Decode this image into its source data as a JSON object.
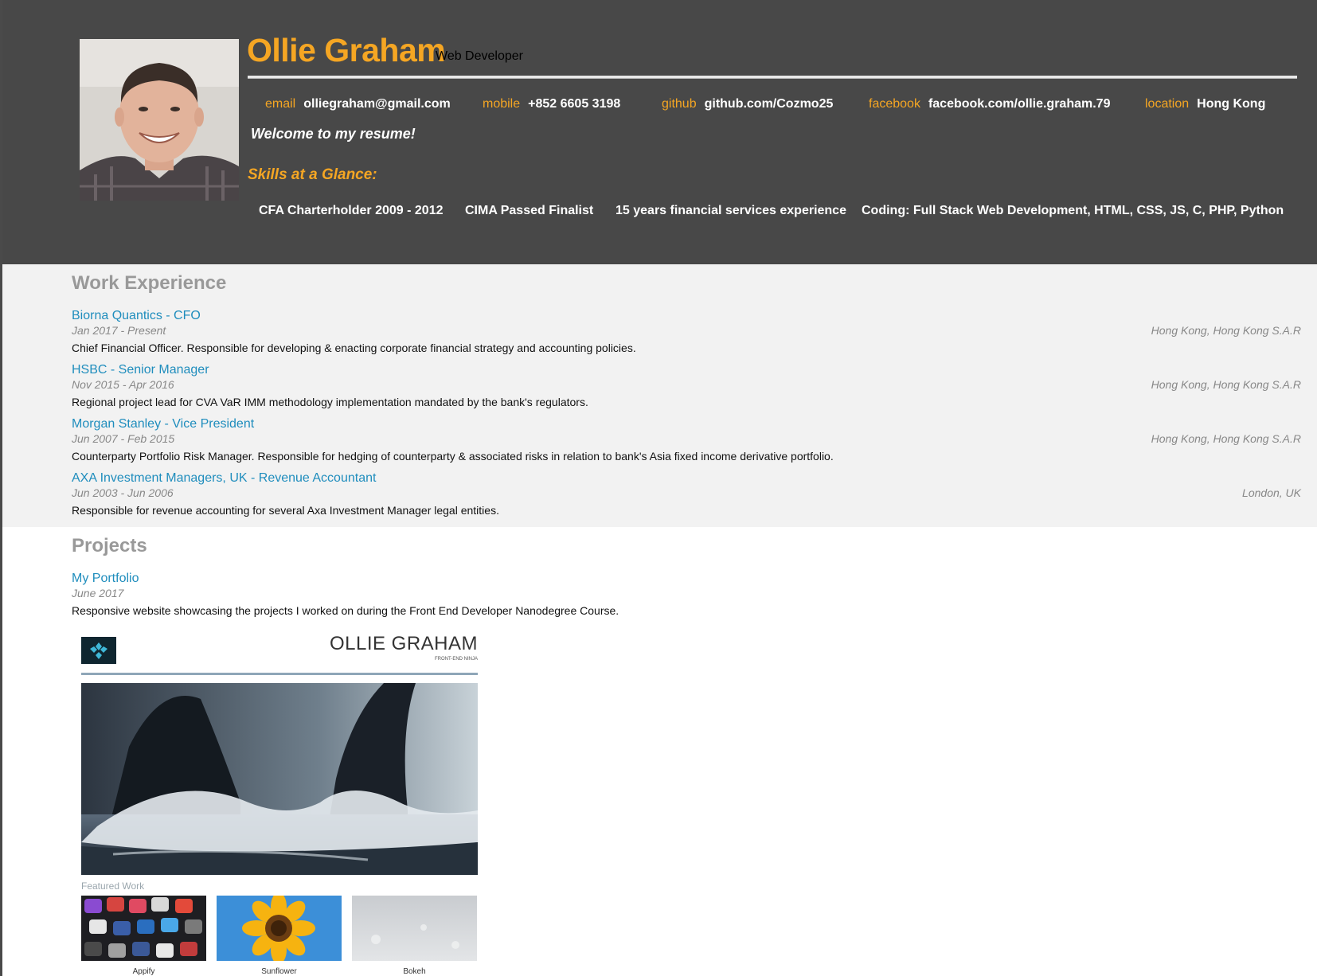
{
  "header": {
    "name": "Ollie Graham",
    "role": "Web Developer",
    "welcome": "Welcome to my resume!",
    "contacts": [
      {
        "key": "email",
        "value": "olliegraham@gmail.com"
      },
      {
        "key": "mobile",
        "value": "+852 6605 3198"
      },
      {
        "key": "github",
        "value": "github.com/Cozmo25"
      },
      {
        "key": "facebook",
        "value": "facebook.com/ollie.graham.79"
      },
      {
        "key": "location",
        "value": "Hong Kong"
      }
    ],
    "skills_title": "Skills at a Glance:",
    "skills": [
      "CFA Charterholder 2009 - 2012",
      "CIMA Passed Finalist",
      "15 years financial services experience",
      "Coding: Full Stack Web Development, HTML, CSS, JS, C, PHP, Python"
    ]
  },
  "work": {
    "title": "Work Experience",
    "jobs": [
      {
        "title": "Biorna Quantics - CFO",
        "dates": "Jan 2017 - Present",
        "location": "Hong Kong, Hong Kong S.A.R",
        "description": "Chief Financial Officer. Responsible for developing & enacting corporate financial strategy and accounting policies."
      },
      {
        "title": "HSBC - Senior Manager",
        "dates": "Nov 2015 - Apr 2016",
        "location": "Hong Kong, Hong Kong S.A.R",
        "description": "Regional project lead for CVA VaR IMM methodology implementation mandated by the bank's regulators."
      },
      {
        "title": "Morgan Stanley - Vice President",
        "dates": "Jun 2007 - Feb 2015",
        "location": "Hong Kong, Hong Kong S.A.R",
        "description": "Counterparty Portfolio Risk Manager. Responsible for hedging of counterparty & associated risks in relation to bank's Asia fixed income derivative portfolio."
      },
      {
        "title": "AXA Investment Managers, UK - Revenue Accountant",
        "dates": "Jun 2003 - Jun 2006",
        "location": "London, UK",
        "description": "Responsible for revenue accounting for several Axa Investment Manager legal entities."
      }
    ]
  },
  "projects": {
    "title": "Projects",
    "items": [
      {
        "title": "My Portfolio",
        "dates": "June 2017",
        "description": "Responsive website showcasing the projects I worked on during the Front End Developer Nanodegree Course.",
        "screenshot": {
          "brand": "OLLIE GRAHAM",
          "tagline": "FRONT-END NINJA",
          "featured_label": "Featured Work",
          "thumbnails": [
            "Appify",
            "Sunflower",
            "Bokeh"
          ]
        }
      }
    ]
  },
  "colors": {
    "header_bg": "#484848",
    "accent": "#f5a623",
    "link": "#1f8dbd",
    "work_bg": "#f2f2f2",
    "muted": "#888888"
  }
}
